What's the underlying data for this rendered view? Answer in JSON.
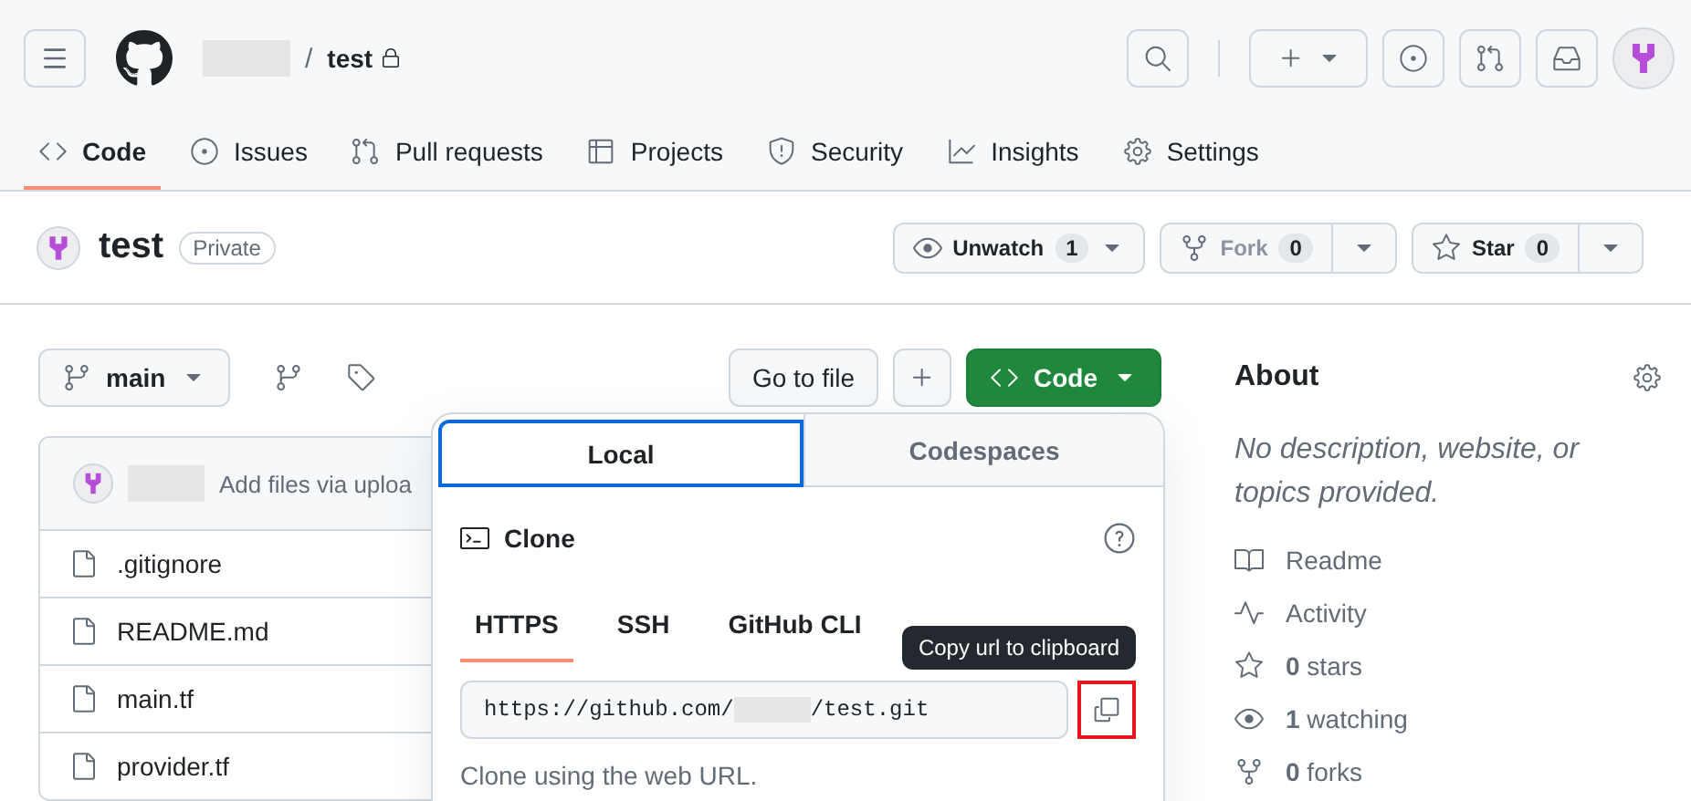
{
  "header": {
    "repo_path": {
      "separator": "/",
      "name": "test"
    },
    "nav": [
      {
        "label": "Code",
        "selected": true
      },
      {
        "label": "Issues",
        "selected": false
      },
      {
        "label": "Pull requests",
        "selected": false
      },
      {
        "label": "Projects",
        "selected": false
      },
      {
        "label": "Security",
        "selected": false
      },
      {
        "label": "Insights",
        "selected": false
      },
      {
        "label": "Settings",
        "selected": false
      }
    ]
  },
  "repo": {
    "name": "test",
    "visibility": "Private",
    "actions": [
      {
        "kind": "watch",
        "label": "Unwatch",
        "count": "1"
      },
      {
        "kind": "fork",
        "label": "Fork",
        "count": "0"
      },
      {
        "kind": "star",
        "label": "Star",
        "count": "0"
      }
    ]
  },
  "toolbar": {
    "branch": "main",
    "go_to_file": "Go to file",
    "code_button": "Code"
  },
  "files": {
    "commit_message": "Add files via uploa",
    "rows": [
      ".gitignore",
      "README.md",
      "main.tf",
      "provider.tf"
    ]
  },
  "clone_popup": {
    "tabs": [
      {
        "label": "Local",
        "selected": true
      },
      {
        "label": "Codespaces",
        "selected": false
      }
    ],
    "title": "Clone",
    "methods": [
      {
        "label": "HTTPS",
        "selected": true
      },
      {
        "label": "SSH",
        "selected": false
      },
      {
        "label": "GitHub CLI",
        "selected": false
      }
    ],
    "url_prefix": "https://github.com/",
    "url_suffix": "/test.git",
    "tooltip": "Copy url to clipboard",
    "hint": "Clone using the web URL."
  },
  "about": {
    "title": "About",
    "description": "No description, website, or topics provided.",
    "links": [
      {
        "label": "Readme"
      },
      {
        "label": "Activity"
      },
      {
        "label": "**0** stars"
      },
      {
        "label": "**1** watching"
      },
      {
        "label": "**0** forks"
      }
    ]
  }
}
